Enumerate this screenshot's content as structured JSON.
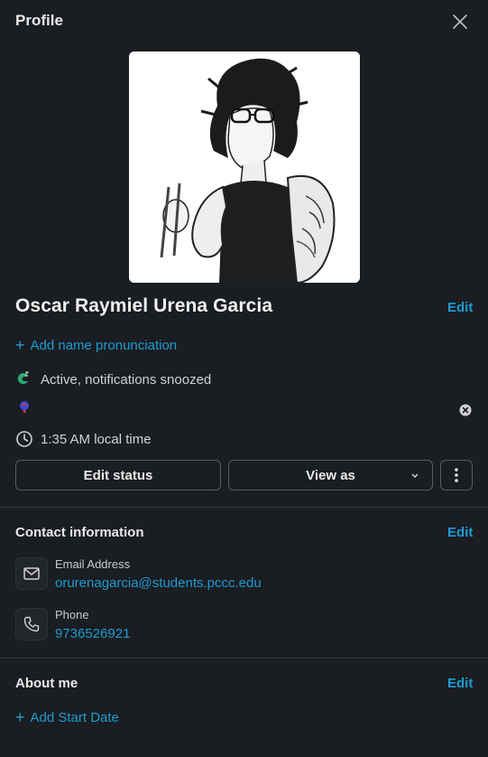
{
  "header": {
    "title": "Profile"
  },
  "profile": {
    "name": "Oscar Raymiel Urena Garcia",
    "edit_label": "Edit",
    "add_pronunciation": "Add name pronunciation",
    "status_text": "Active, notifications snoozed",
    "local_time": "1:35 AM local time"
  },
  "actions": {
    "edit_status": "Edit status",
    "view_as": "View as"
  },
  "contact": {
    "title": "Contact information",
    "edit_label": "Edit",
    "email_label": "Email Address",
    "email_value": "orurenagarcia@students.pccc.edu",
    "phone_label": "Phone",
    "phone_value": "9736526921"
  },
  "about": {
    "title": "About me",
    "edit_label": "Edit",
    "add_start_date": "Add Start Date"
  },
  "colors": {
    "background": "#1a1d21",
    "link": "#1d9bd1",
    "active": "#2bac76"
  },
  "icons": [
    "close-icon",
    "active-status-icon",
    "status-emoji-icon",
    "clear-status-icon",
    "clock-icon",
    "chevron-down-icon",
    "more-vertical-icon",
    "email-icon",
    "phone-icon",
    "plus-icon"
  ]
}
